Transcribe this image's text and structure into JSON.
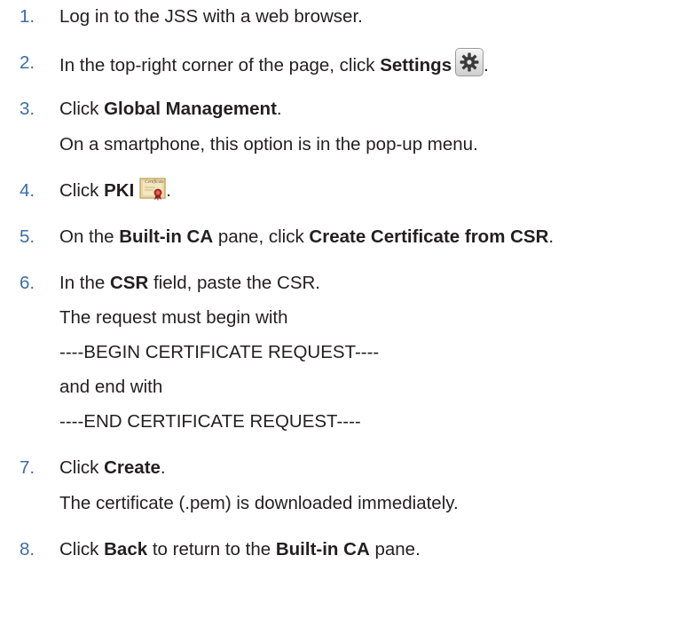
{
  "steps": [
    {
      "number": "1.",
      "text": "Log in to the JSS with a web browser."
    },
    {
      "number": "2.",
      "pre": "In the top-right corner of the page, click ",
      "bold": "Settings",
      "post": ".",
      "icon": "settings-gear-icon"
    },
    {
      "number": "3.",
      "pre": "Click ",
      "bold": "Global Management",
      "post": ".",
      "note": "On a smartphone, this option is in the pop-up menu."
    },
    {
      "number": "4.",
      "pre": "Click ",
      "bold": "PKI",
      "post": ".",
      "icon": "certificate-icon",
      "icon_label": "Certificate"
    },
    {
      "number": "5.",
      "pre": "On the ",
      "bold": "Built-in CA",
      "mid": " pane, click ",
      "bold2": "Create Certificate from CSR",
      "post": "."
    },
    {
      "number": "6.",
      "pre": "In the ",
      "bold": "CSR",
      "post": " field, paste the CSR.",
      "notes": [
        "The request must begin with",
        "----BEGIN CERTIFICATE REQUEST----",
        "and end with",
        "----END CERTIFICATE REQUEST----"
      ]
    },
    {
      "number": "7.",
      "pre": "Click ",
      "bold": "Create",
      "post": ".",
      "note": "The certificate (.pem) is downloaded immediately."
    },
    {
      "number": "8.",
      "pre": "Click ",
      "bold": "Back",
      "mid": " to return to the ",
      "bold2": "Built-in CA",
      "post": " pane."
    }
  ],
  "colors": {
    "number": "#3b6ea8",
    "text": "#231f20"
  }
}
